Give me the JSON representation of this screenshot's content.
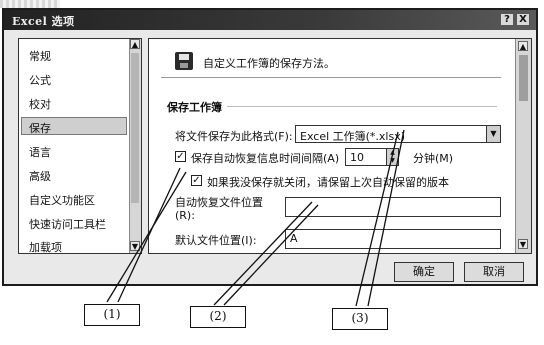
{
  "dialog": {
    "title": "Excel 选项",
    "help_button": "?",
    "close_button": "X"
  },
  "nav": {
    "items": [
      {
        "label": "常规"
      },
      {
        "label": "公式"
      },
      {
        "label": "校对"
      },
      {
        "label": "保存",
        "selected": true
      },
      {
        "label": "语言"
      },
      {
        "label": "高级"
      },
      {
        "label": "自定义功能区"
      },
      {
        "label": "快速访问工具栏"
      },
      {
        "label": "加载项"
      }
    ]
  },
  "main": {
    "header": "自定义工作簿的保存方法。",
    "section_title": "保存工作簿",
    "format_label": "将文件保存为此格式(F):",
    "format_value": "Excel 工作簿(*.xlsx)",
    "autorecover_label": "保存自动恢复信息时间间隔(A)",
    "autorecover_checked": true,
    "autorecover_value": "10",
    "autorecover_unit": "分钟(M)",
    "keep_version_label": "如果我没保存就关闭，请保留上次自动保留的版本",
    "keep_version_checked": true,
    "recover_location_label_1": "自动恢复文件位置",
    "recover_location_label_2": "(R):",
    "recover_location_value": "",
    "default_location_label": "默认文件位置(I):",
    "default_location_value": "A"
  },
  "buttons": {
    "ok": "确定",
    "cancel": "取消"
  },
  "callouts": {
    "c1": "(1)",
    "c2": "(2)",
    "c3": "(3)"
  }
}
